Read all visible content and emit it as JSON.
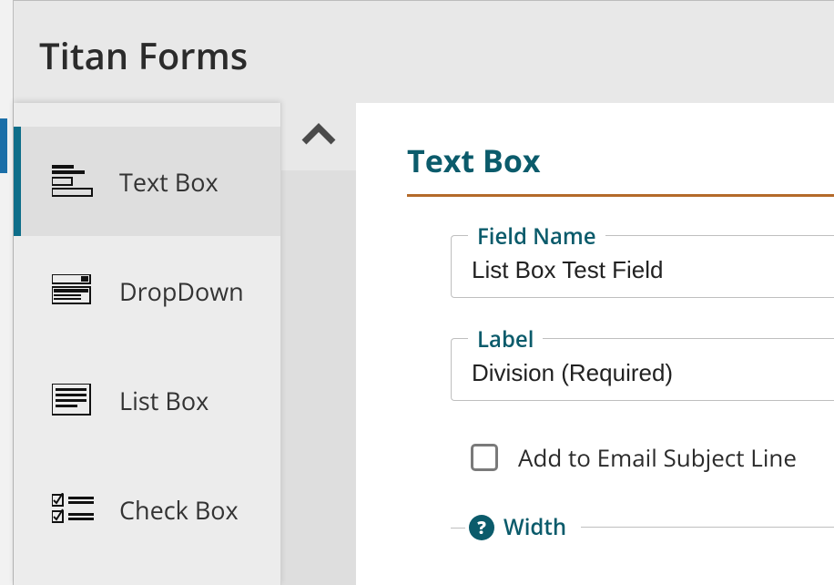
{
  "app_title": "Titan Forms",
  "sidebar": {
    "items": [
      {
        "label": "Text Box",
        "icon": "textbox",
        "selected": true
      },
      {
        "label": "DropDown",
        "icon": "dropdown",
        "selected": false
      },
      {
        "label": "List Box",
        "icon": "listbox",
        "selected": false
      },
      {
        "label": "Check Box",
        "icon": "checkbox",
        "selected": false
      }
    ]
  },
  "main": {
    "title": "Text Box",
    "field_name": {
      "legend": "Field Name",
      "value": "List Box Test Field"
    },
    "label": {
      "legend": "Label",
      "value": "Division (Required)"
    },
    "email_subject_checkbox": {
      "label": "Add to Email Subject Line",
      "checked": false
    },
    "width": {
      "legend": "Width",
      "help": "?"
    }
  },
  "collapse_icon": "chevron-up"
}
